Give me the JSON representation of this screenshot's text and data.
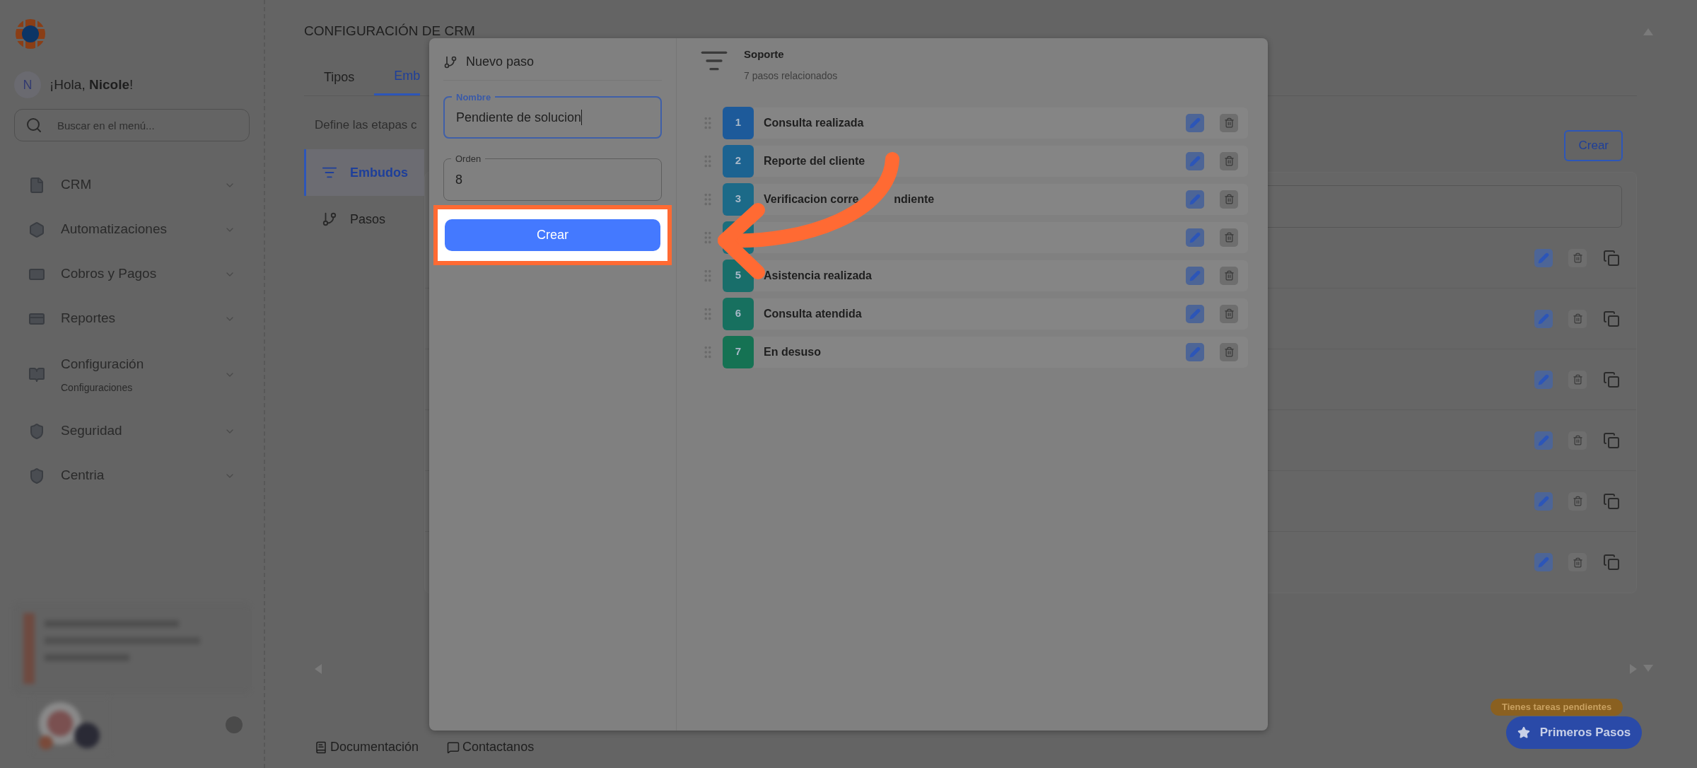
{
  "sidebar": {
    "avatar_initial": "N",
    "greeting": "¡Hola, **Nicole**!",
    "search": {
      "placeholder": "Buscar en el menú..."
    },
    "items": [
      {
        "label": "CRM"
      },
      {
        "label": "Automatizaciones"
      },
      {
        "label": "Cobros y Pagos"
      },
      {
        "label": "Reportes"
      },
      {
        "label": "Configuración",
        "sublabel": "Configuraciones"
      },
      {
        "label": "Seguridad"
      },
      {
        "label": "Centria"
      }
    ]
  },
  "main": {
    "title": "CONFIGURACIÓN DE CRM",
    "tabs": [
      {
        "label": "Tipos",
        "selected": false
      },
      {
        "label": "Emb",
        "selected": true
      }
    ],
    "description": "Define las etapas c",
    "nav": [
      {
        "label": "Embudos",
        "selected": true
      },
      {
        "label": "Pasos",
        "selected": false
      }
    ],
    "create_button": "Crear"
  },
  "footer": {
    "links": [
      "Documentación",
      "Contactanos"
    ]
  },
  "tasks_badge": "Tienes tareas pendientes",
  "first_steps_button": "Primeros Pasos",
  "modal": {
    "title": "Nuevo paso",
    "fields": [
      {
        "label": "Nombre",
        "value": "Pendiente de solucion",
        "focused": true
      },
      {
        "label": "Orden",
        "value": "8",
        "focused": false
      }
    ],
    "submit": "Crear",
    "funnel": {
      "name": "Soporte",
      "subtitle": "7 pasos relacionados"
    },
    "steps": [
      {
        "number": "1",
        "label": "Consulta realizada",
        "color": "#1d5a9a"
      },
      {
        "number": "2",
        "label": "Reporte del cliente",
        "color": "#1c6391"
      },
      {
        "number": "3",
        "label": "Verificacion corre",
        "label_tail": "ndiente",
        "color": "#1c6a88"
      },
      {
        "color": "#1b6e7c"
      },
      {
        "number": "5",
        "label": "Asistencia realizada",
        "color": "#186e6a"
      },
      {
        "number": "6",
        "label": "Consulta atendida",
        "color": "#17705f"
      },
      {
        "number": "7",
        "label": "En desuso",
        "color": "#157253"
      }
    ]
  }
}
